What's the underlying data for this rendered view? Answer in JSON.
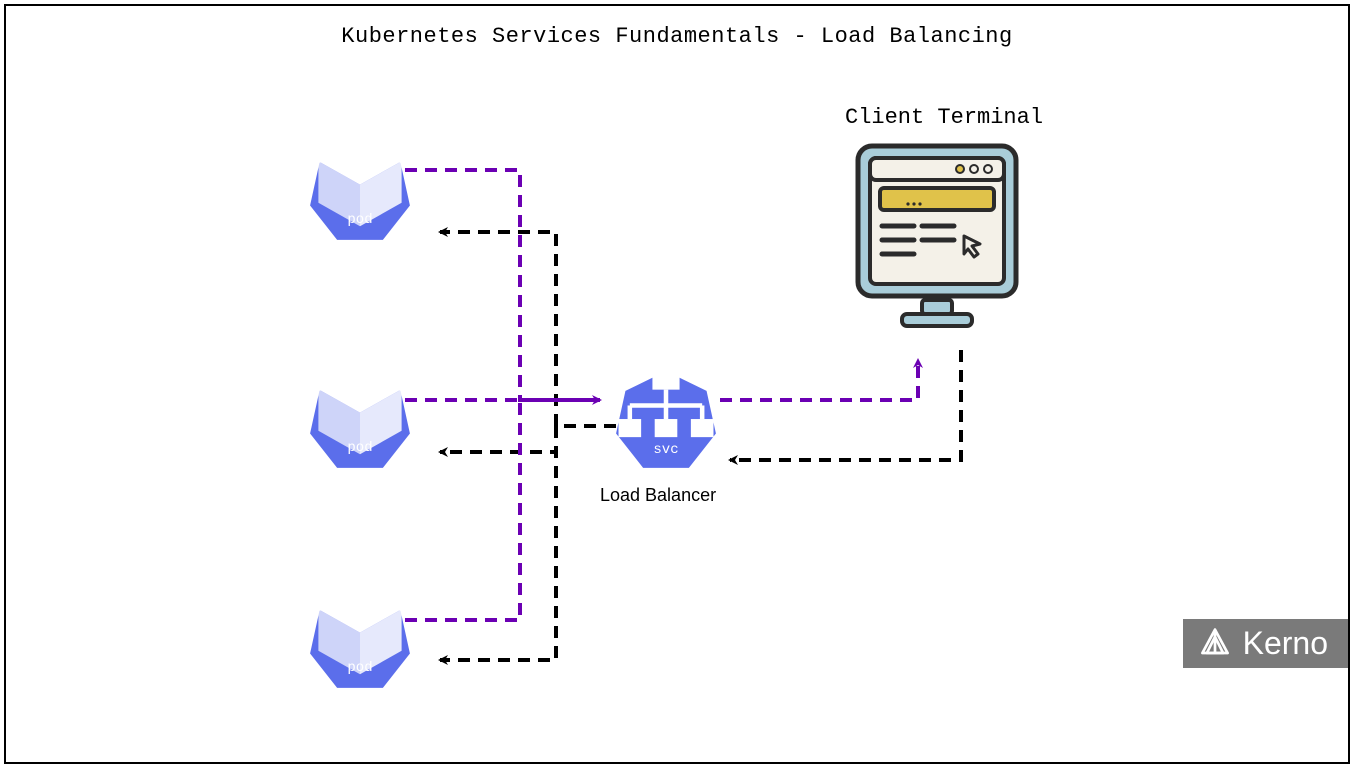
{
  "title": "Kubernetes Services Fundamentals - Load Balancing",
  "pods": [
    {
      "label": "pod"
    },
    {
      "label": "pod"
    },
    {
      "label": "pod"
    }
  ],
  "service": {
    "label": "svc",
    "caption": "Load Balancer"
  },
  "client": {
    "title": "Client Terminal"
  },
  "brand": {
    "name": "Kerno"
  },
  "colors": {
    "k8s_blue": "#5b6eeb",
    "purple": "#6b00b3",
    "black": "#000000",
    "badge_gray": "#7a7a7a",
    "terminal_light": "#a9cdd9",
    "terminal_yellow": "#e0c24a"
  }
}
